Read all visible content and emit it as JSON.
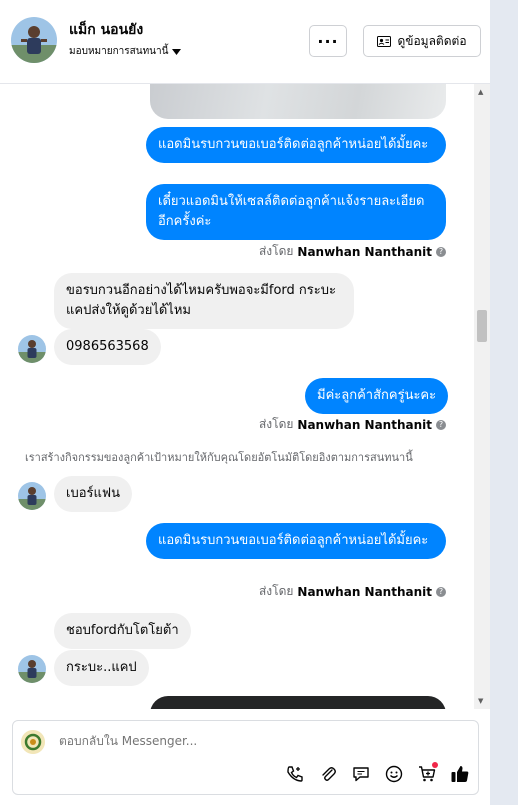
{
  "header": {
    "name": "แม็ก นอนยัง",
    "assign_label": "มอบหมายการสนทนานี้",
    "more_label": "···",
    "contact_label": "ดูข้อมูลติดต่อ"
  },
  "messages": [
    {
      "type": "image-out"
    },
    {
      "type": "out",
      "text": "แอดมินรบกวนขอเบอร์ติดต่อลูกค้าหน่อยได้มั้ยคะ"
    },
    {
      "type": "out",
      "text": "เดี๋ยวแอดมินให้เซลล์ติดต่อลูกค้าแจ้งรายละเอียดอีกครั้งค่ะ"
    },
    {
      "type": "sentby",
      "prefix": "ส่งโดย",
      "name": "Nanwhan Nanthanit"
    },
    {
      "type": "in",
      "text": "ขอรบกวนอีกอย่างได้ไหมครับพอจะมีford กระบะแคปส่งให้ดูด้วยได้ไหม"
    },
    {
      "type": "in",
      "text": "0986563568"
    },
    {
      "type": "out",
      "text": "มีค่ะลูกค้าสักครู่นะคะ"
    },
    {
      "type": "sentby",
      "prefix": "ส่งโดย",
      "name": "Nanwhan Nanthanit"
    },
    {
      "type": "system",
      "text": "เราสร้างกิจกรรมของลูกค้าเป้าหมายให้กับคุณโดยอัตโนมัติโดยอิงตามการสนทนานี้"
    },
    {
      "type": "in",
      "text": "เบอร์แฟน"
    },
    {
      "type": "out",
      "text": "แอดมินรบกวนขอเบอร์ติดต่อลูกค้าหน่อยได้มั้ยคะ"
    },
    {
      "type": "sentby",
      "prefix": "ส่งโดย",
      "name": "Nanwhan Nanthanit"
    },
    {
      "type": "in",
      "text": "ชอบfordกับโตโยต้า"
    },
    {
      "type": "in",
      "text": "กระบะ..แคป"
    }
  ],
  "composer": {
    "placeholder": "ตอบกลับใน Messenger..."
  },
  "toolbar_icons": [
    "phone-icon",
    "paperclip-icon",
    "chat-bubble-icon",
    "emoji-icon",
    "cart-add-icon",
    "thumbs-up-icon"
  ],
  "colors": {
    "outgoing": "#0084ff",
    "incoming": "#f0f0f0",
    "notification": "#f02849"
  }
}
